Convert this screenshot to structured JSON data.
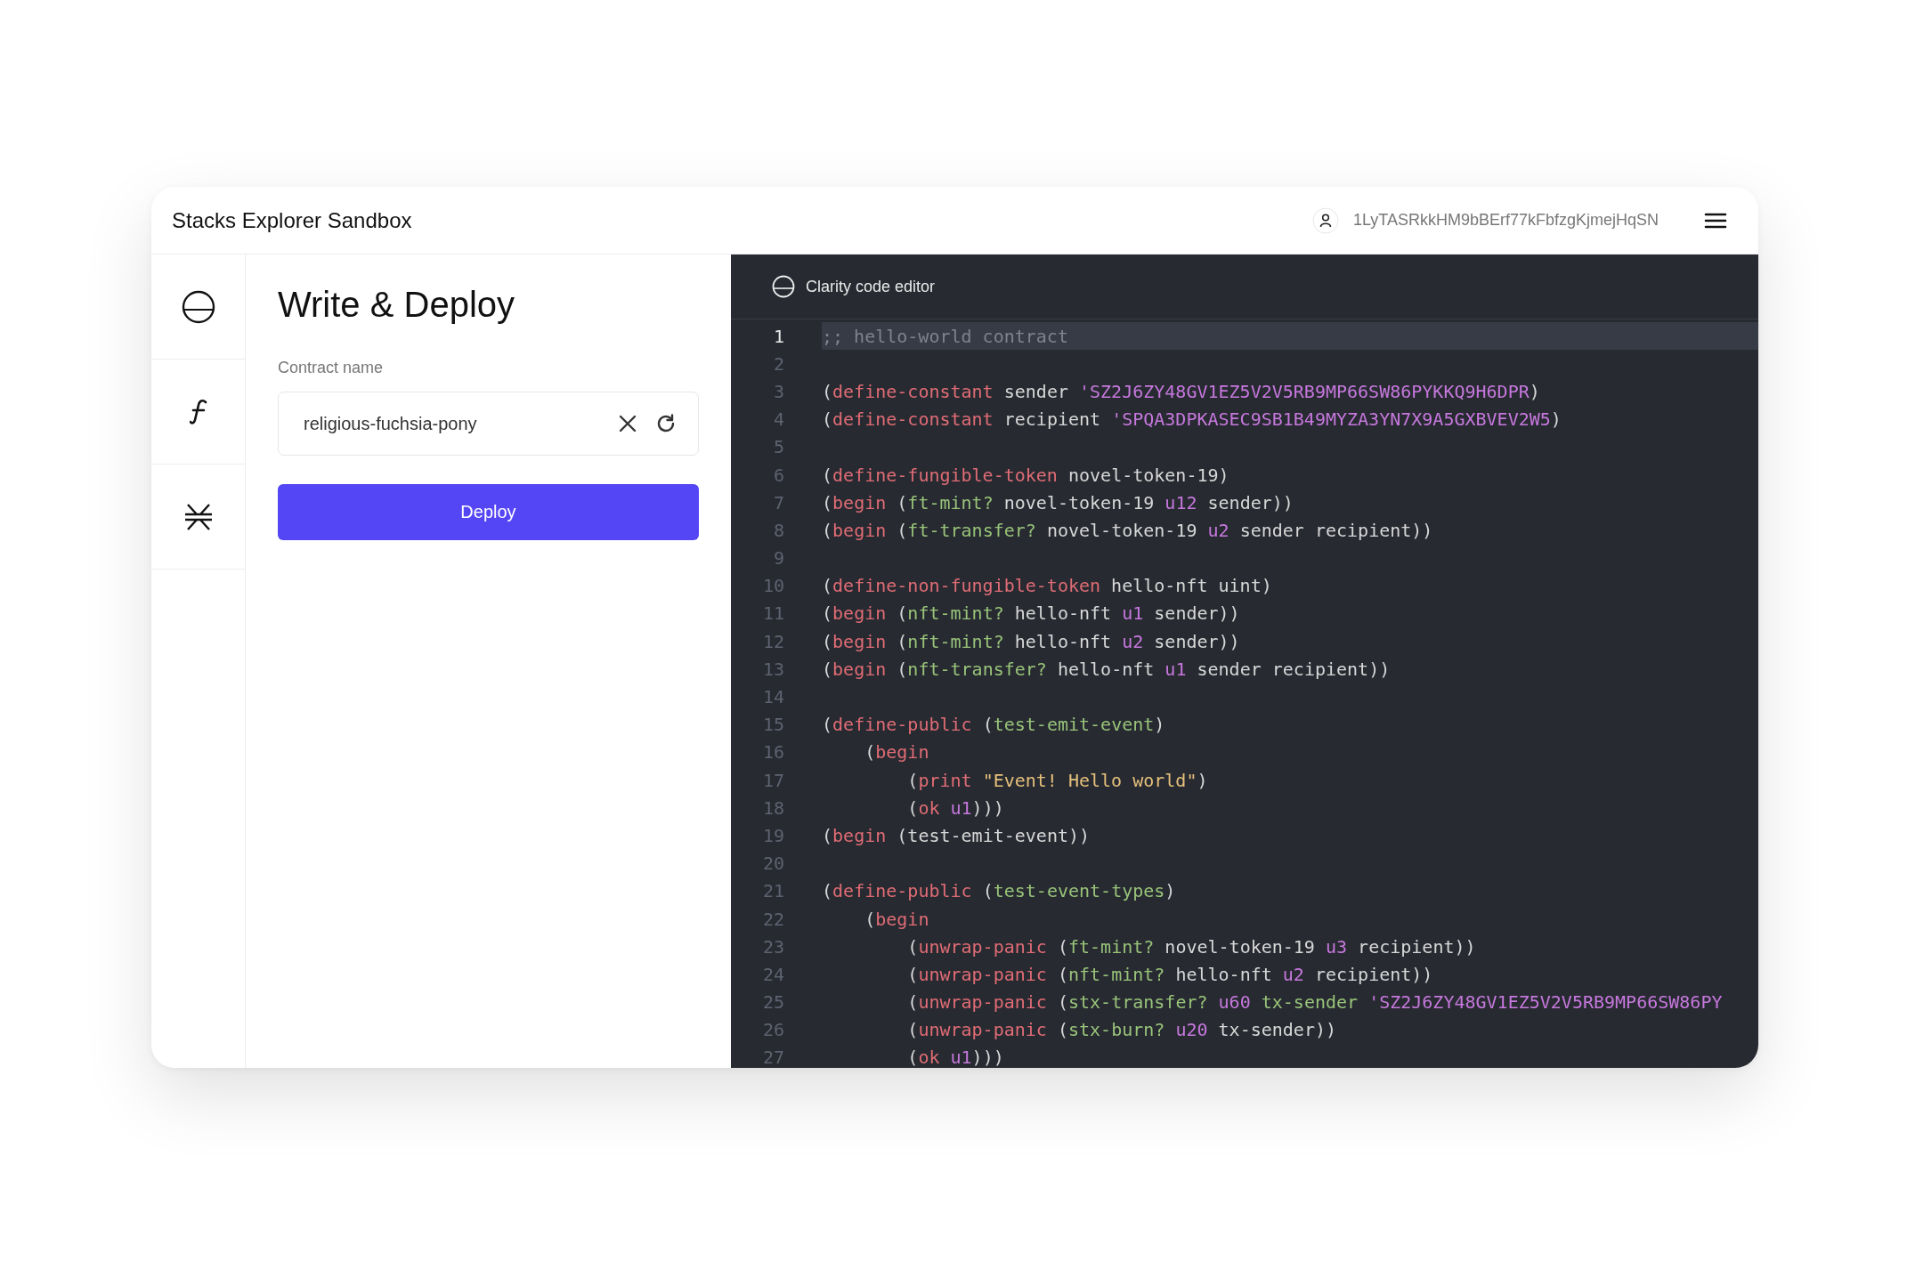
{
  "header": {
    "title": "Stacks Explorer Sandbox",
    "account": "1LyTASRkkHM9bBErf77kFbfzgKjmejHqSN"
  },
  "sidebar": {
    "items": [
      {
        "kind": "clarity"
      },
      {
        "kind": "function"
      },
      {
        "kind": "stacks"
      }
    ]
  },
  "panel": {
    "title": "Write & Deploy",
    "field_label": "Contract name",
    "field_value": "religious-fuchsia-pony",
    "button": "Deploy"
  },
  "editor": {
    "title": "Clarity code editor",
    "lines": [
      {
        "number": "1",
        "active": true,
        "tokens": [
          {
            "text": ";; hello-world contract",
            "kind": "comment"
          }
        ]
      },
      {
        "number": "2",
        "active": false
      },
      {
        "number": "3",
        "active": false,
        "tokens": [
          {
            "text": "(",
            "kind": "plain"
          },
          {
            "text": "define-constant",
            "kind": "kw"
          },
          {
            "text": " sender ",
            "kind": "plain"
          },
          {
            "text": "'SZ2J6ZY48GV1EZ5V2V5RB9MP66SW86PYKKQ9H6DPR",
            "kind": "lit"
          },
          {
            "text": ")",
            "kind": "plain"
          }
        ]
      },
      {
        "number": "4",
        "active": false,
        "tokens": [
          {
            "text": "(",
            "kind": "plain"
          },
          {
            "text": "define-constant",
            "kind": "kw"
          },
          {
            "text": " recipient ",
            "kind": "plain"
          },
          {
            "text": "'SPQA3DPKASEC9SB1B49MYZA3YN7X9A5GXBVEV2W5",
            "kind": "lit"
          },
          {
            "text": ")",
            "kind": "plain"
          }
        ]
      },
      {
        "number": "5",
        "active": false
      },
      {
        "number": "6",
        "active": false,
        "tokens": [
          {
            "text": "(",
            "kind": "plain"
          },
          {
            "text": "define-fungible-token",
            "kind": "kw"
          },
          {
            "text": " novel-token-19)",
            "kind": "plain"
          }
        ]
      },
      {
        "number": "7",
        "active": false,
        "tokens": [
          {
            "text": "(",
            "kind": "plain"
          },
          {
            "text": "begin",
            "kind": "kw"
          },
          {
            "text": " (",
            "kind": "plain"
          },
          {
            "text": "ft-mint?",
            "kind": "fn"
          },
          {
            "text": " novel-token-19 ",
            "kind": "plain"
          },
          {
            "text": "u12",
            "kind": "lit"
          },
          {
            "text": " sender))",
            "kind": "plain"
          }
        ]
      },
      {
        "number": "8",
        "active": false,
        "tokens": [
          {
            "text": "(",
            "kind": "plain"
          },
          {
            "text": "begin",
            "kind": "kw"
          },
          {
            "text": " (",
            "kind": "plain"
          },
          {
            "text": "ft-transfer?",
            "kind": "fn"
          },
          {
            "text": " novel-token-19 ",
            "kind": "plain"
          },
          {
            "text": "u2",
            "kind": "lit"
          },
          {
            "text": " sender recipient))",
            "kind": "plain"
          }
        ]
      },
      {
        "number": "9",
        "active": false
      },
      {
        "number": "10",
        "active": false,
        "tokens": [
          {
            "text": "(",
            "kind": "plain"
          },
          {
            "text": "define-non-fungible-token",
            "kind": "kw"
          },
          {
            "text": " hello-nft uint)",
            "kind": "plain"
          }
        ]
      },
      {
        "number": "11",
        "active": false,
        "tokens": [
          {
            "text": "(",
            "kind": "plain"
          },
          {
            "text": "begin",
            "kind": "kw"
          },
          {
            "text": " (",
            "kind": "plain"
          },
          {
            "text": "nft-mint?",
            "kind": "fn"
          },
          {
            "text": " hello-nft ",
            "kind": "plain"
          },
          {
            "text": "u1",
            "kind": "lit"
          },
          {
            "text": " sender))",
            "kind": "plain"
          }
        ]
      },
      {
        "number": "12",
        "active": false,
        "tokens": [
          {
            "text": "(",
            "kind": "plain"
          },
          {
            "text": "begin",
            "kind": "kw"
          },
          {
            "text": " (",
            "kind": "plain"
          },
          {
            "text": "nft-mint?",
            "kind": "fn"
          },
          {
            "text": " hello-nft ",
            "kind": "plain"
          },
          {
            "text": "u2",
            "kind": "lit"
          },
          {
            "text": " sender))",
            "kind": "plain"
          }
        ]
      },
      {
        "number": "13",
        "active": false,
        "tokens": [
          {
            "text": "(",
            "kind": "plain"
          },
          {
            "text": "begin",
            "kind": "kw"
          },
          {
            "text": " (",
            "kind": "plain"
          },
          {
            "text": "nft-transfer?",
            "kind": "fn"
          },
          {
            "text": " hello-nft ",
            "kind": "plain"
          },
          {
            "text": "u1",
            "kind": "lit"
          },
          {
            "text": " sender recipient))",
            "kind": "plain"
          }
        ]
      },
      {
        "number": "14",
        "active": false
      },
      {
        "number": "15",
        "active": false,
        "tokens": [
          {
            "text": "(",
            "kind": "plain"
          },
          {
            "text": "define-public",
            "kind": "kw"
          },
          {
            "text": " (",
            "kind": "plain"
          },
          {
            "text": "test-emit-event",
            "kind": "fn"
          },
          {
            "text": ")",
            "kind": "plain"
          }
        ]
      },
      {
        "number": "16",
        "active": false,
        "tokens": [
          {
            "text": "    (",
            "kind": "plain"
          },
          {
            "text": "begin",
            "kind": "kw"
          }
        ]
      },
      {
        "number": "17",
        "active": false,
        "tokens": [
          {
            "text": "        (",
            "kind": "plain"
          },
          {
            "text": "print ",
            "kind": "kw"
          },
          {
            "text": "\"Event! Hello world\"",
            "kind": "str"
          },
          {
            "text": ")",
            "kind": "plain"
          }
        ]
      },
      {
        "number": "18",
        "active": false,
        "tokens": [
          {
            "text": "        (",
            "kind": "plain"
          },
          {
            "text": "ok ",
            "kind": "kw"
          },
          {
            "text": "u1",
            "kind": "lit"
          },
          {
            "text": ")))",
            "kind": "plain"
          }
        ]
      },
      {
        "number": "19",
        "active": false,
        "tokens": [
          {
            "text": "(",
            "kind": "plain"
          },
          {
            "text": "begin",
            "kind": "kw"
          },
          {
            "text": " (test-emit-event))",
            "kind": "plain"
          }
        ]
      },
      {
        "number": "20",
        "active": false
      },
      {
        "number": "21",
        "active": false,
        "tokens": [
          {
            "text": "(",
            "kind": "plain"
          },
          {
            "text": "define-public",
            "kind": "kw"
          },
          {
            "text": " (",
            "kind": "plain"
          },
          {
            "text": "test-event-types",
            "kind": "fn"
          },
          {
            "text": ")",
            "kind": "plain"
          }
        ]
      },
      {
        "number": "22",
        "active": false,
        "tokens": [
          {
            "text": "    (",
            "kind": "plain"
          },
          {
            "text": "begin",
            "kind": "kw"
          }
        ]
      },
      {
        "number": "23",
        "active": false,
        "tokens": [
          {
            "text": "        (",
            "kind": "plain"
          },
          {
            "text": "unwrap-panic",
            "kind": "kw"
          },
          {
            "text": " (",
            "kind": "plain"
          },
          {
            "text": "ft-mint?",
            "kind": "fn"
          },
          {
            "text": " novel-token-19 ",
            "kind": "plain"
          },
          {
            "text": "u3",
            "kind": "lit"
          },
          {
            "text": " recipient))",
            "kind": "plain"
          }
        ]
      },
      {
        "number": "24",
        "active": false,
        "tokens": [
          {
            "text": "        (",
            "kind": "plain"
          },
          {
            "text": "unwrap-panic",
            "kind": "kw"
          },
          {
            "text": " (",
            "kind": "plain"
          },
          {
            "text": "nft-mint?",
            "kind": "fn"
          },
          {
            "text": " hello-nft ",
            "kind": "plain"
          },
          {
            "text": "u2",
            "kind": "lit"
          },
          {
            "text": " recipient))",
            "kind": "plain"
          }
        ]
      },
      {
        "number": "25",
        "active": false,
        "tokens": [
          {
            "text": "        (",
            "kind": "plain"
          },
          {
            "text": "unwrap-panic",
            "kind": "kw"
          },
          {
            "text": " (",
            "kind": "plain"
          },
          {
            "text": "stx-transfer? ",
            "kind": "fn"
          },
          {
            "text": "u60",
            "kind": "lit"
          },
          {
            "text": " tx-sender ",
            "kind": "fn"
          },
          {
            "text": "'SZ2J6ZY48GV1EZ5V2V5RB9MP66SW86PY",
            "kind": "lit"
          }
        ]
      },
      {
        "number": "26",
        "active": false,
        "tokens": [
          {
            "text": "        (",
            "kind": "plain"
          },
          {
            "text": "unwrap-panic",
            "kind": "kw"
          },
          {
            "text": " (",
            "kind": "plain"
          },
          {
            "text": "stx-burn? ",
            "kind": "fn"
          },
          {
            "text": "u20",
            "kind": "lit"
          },
          {
            "text": " tx-sender))",
            "kind": "plain"
          }
        ]
      },
      {
        "number": "27",
        "active": false,
        "tokens": [
          {
            "text": "        (",
            "kind": "plain"
          },
          {
            "text": "ok ",
            "kind": "kw"
          },
          {
            "text": "u1",
            "kind": "lit"
          },
          {
            "text": ")))",
            "kind": "plain"
          }
        ]
      }
    ]
  }
}
